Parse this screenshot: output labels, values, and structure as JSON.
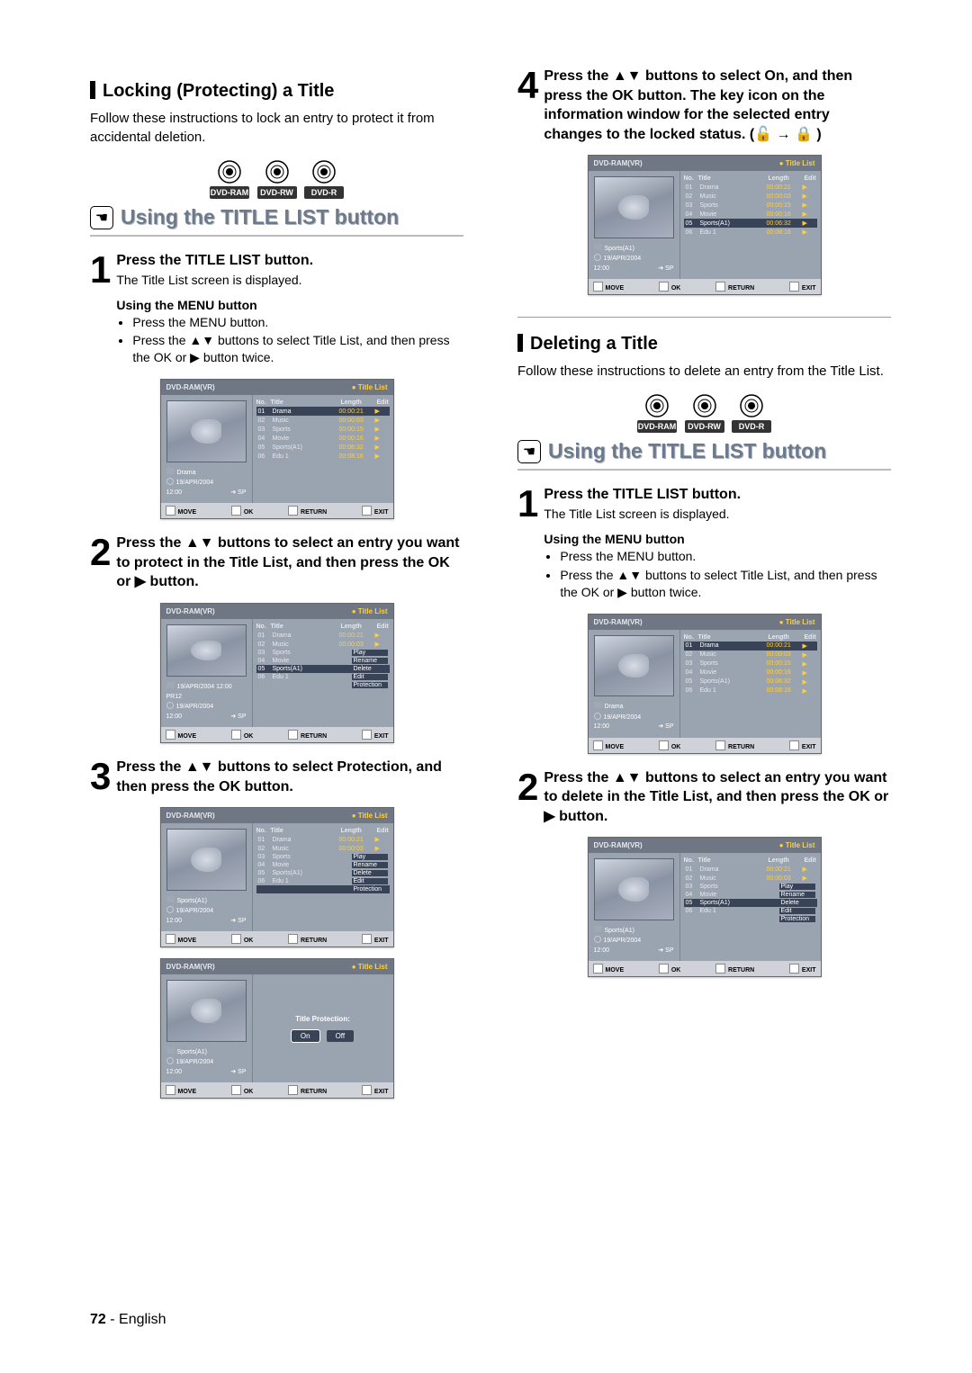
{
  "page_number": "72",
  "lang": "English",
  "discs": {
    "ram": "DVD-RAM",
    "rw": "DVD-RW",
    "r": "DVD-R"
  },
  "banner_title": "Using the TITLE LIST button",
  "locking": {
    "heading": "Locking (Protecting) a Title",
    "intro": "Follow these instructions to lock an entry to protect it from accidental deletion.",
    "step1_head": "Press the TITLE LIST button.",
    "step1_sub": "The Title List screen is displayed.",
    "menu_sub_h": "Using the MENU button",
    "menu_sub_b1": "Press the MENU button.",
    "menu_sub_b2": "Press the ▲▼ buttons to select Title List, and then press the OK or ▶ button twice.",
    "step2_head": "Press the ▲▼ buttons to select an entry you want to protect in the Title List, and then press the OK or ▶ button.",
    "step3_head": "Press the ▲▼ buttons to select Protection, and then press the OK button.",
    "step4_head": "Press the ▲▼ buttons to select On, and then press the OK button. The key icon on the information window for the selected entry changes to the locked status. (🔓 → 🔒 )"
  },
  "deleting": {
    "heading": "Deleting a Title",
    "intro": "Follow these instructions to delete an entry from the Title List.",
    "step1_head": "Press the TITLE LIST button.",
    "step1_sub": "The Title List screen is displayed.",
    "menu_sub_h": "Using the MENU button",
    "menu_sub_b1": "Press the MENU button.",
    "menu_sub_b2": "Press the ▲▼ buttons to select Title List, and then press the OK or ▶ button twice.",
    "step2_head": "Press the ▲▼ buttons to select an entry you want to delete in the Title List, and then press the OK or ▶ button."
  },
  "screen": {
    "hdr_device": "DVD-RAM(VR)",
    "hdr_title": "Title List",
    "col_no": "No.",
    "col_title": "Title",
    "col_len": "Length",
    "col_edit": "Edit",
    "rows": [
      {
        "no": "01",
        "t": "Drama",
        "len": "00:00:21"
      },
      {
        "no": "02",
        "t": "Music",
        "len": "00:00:03"
      },
      {
        "no": "03",
        "t": "Sports",
        "len": "00:00:15"
      },
      {
        "no": "04",
        "t": "Movie",
        "len": "00:00:16"
      },
      {
        "no": "05",
        "t": "Sports(A1)",
        "len": "00:06:32"
      },
      {
        "no": "06",
        "t": "Edu 1",
        "len": "00:08:16"
      }
    ],
    "info": {
      "title_drama": "Drama",
      "title_sports": "Sports(A1)",
      "title_long": "19/APR/2004 12:00 PR12",
      "date": "19/APR/2004",
      "time": "12:00",
      "mode": "➔ SP"
    },
    "menu_items": [
      "Play",
      "Rename",
      "Delete",
      "Edit",
      "Protection"
    ],
    "prot_label": "Title Protection:",
    "on": "On",
    "off": "Off",
    "foot": {
      "move": "MOVE",
      "ok": "OK",
      "return": "RETURN",
      "exit": "EXIT"
    }
  }
}
